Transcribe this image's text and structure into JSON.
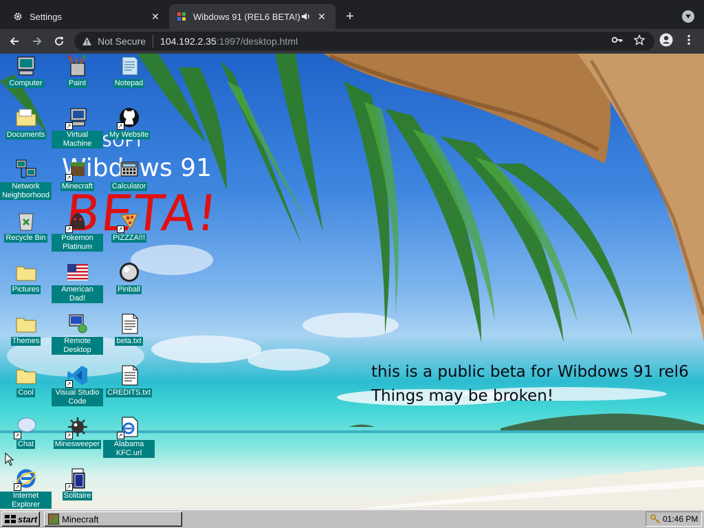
{
  "browser": {
    "tabs": [
      {
        "title": "Settings",
        "icon": "gear-icon",
        "active": false
      },
      {
        "title": "Wibdows 91 (REL6 BETA!)",
        "icon": "site-icon",
        "active": true,
        "audio": true
      }
    ],
    "new_tab_label": "+",
    "address": {
      "security_label": "Not Secure",
      "host": "104.192.2.35",
      "path": ":1997/desktop.html"
    }
  },
  "desktop": {
    "background_description_colors": {
      "sky": "#2a72d6",
      "sea": "#38cfd2",
      "sand": "#efece2"
    },
    "logo": {
      "top": "MIKASOFT",
      "name": "Wibdows 91",
      "tag": "BETA!"
    },
    "note_line1": "this is a public beta for Wibdows 91 rel6",
    "note_line2": "Things may be broken!",
    "icons": [
      {
        "label": "Computer",
        "icon": "computer-icon",
        "shortcut": false
      },
      {
        "label": "Paint",
        "icon": "paint-icon",
        "shortcut": false
      },
      {
        "label": "Notepad",
        "icon": "notepad-icon",
        "shortcut": false
      },
      {
        "label": "Documents",
        "icon": "folder-icon",
        "shortcut": false
      },
      {
        "label": "Virtual Machine",
        "icon": "virtual-machine-icon",
        "shortcut": true
      },
      {
        "label": "My Website",
        "icon": "github-icon",
        "shortcut": true
      },
      {
        "label": "Network Neighborhood",
        "icon": "network-icon",
        "shortcut": false
      },
      {
        "label": "Minecraft",
        "icon": "minecraft-icon",
        "shortcut": true
      },
      {
        "label": "Calculator",
        "icon": "calculator-icon",
        "shortcut": false
      },
      {
        "label": "Recycle Bin",
        "icon": "recycle-bin-icon",
        "shortcut": false
      },
      {
        "label": "Pokemon Platinum",
        "icon": "pokemon-icon",
        "shortcut": true
      },
      {
        "label": "PIZZZA!!!",
        "icon": "pizza-icon",
        "shortcut": true
      },
      {
        "label": "Pictures",
        "icon": "folder-icon",
        "shortcut": false
      },
      {
        "label": "American Dad!",
        "icon": "flag-icon",
        "shortcut": false
      },
      {
        "label": "Pinball",
        "icon": "pinball-icon",
        "shortcut": false
      },
      {
        "label": "Themes",
        "icon": "folder-icon",
        "shortcut": false
      },
      {
        "label": "Remote Desktop",
        "icon": "remote-desktop-icon",
        "shortcut": false
      },
      {
        "label": "beta.txt",
        "icon": "text-file-icon",
        "shortcut": false
      },
      {
        "label": "Cool",
        "icon": "folder-icon",
        "shortcut": false
      },
      {
        "label": "Visual Studio Code",
        "icon": "vscode-icon",
        "shortcut": true
      },
      {
        "label": "CREDITS.txt",
        "icon": "text-file-icon",
        "shortcut": false
      },
      {
        "label": "Chat",
        "icon": "chat-icon",
        "shortcut": true
      },
      {
        "label": "Minesweeper",
        "icon": "minesweeper-icon",
        "shortcut": true
      },
      {
        "label": "Alabama KFC.url",
        "icon": "internet-shortcut-icon",
        "shortcut": true
      },
      {
        "label": "Internet Explorer",
        "icon": "internet-explorer-icon",
        "shortcut": true
      },
      {
        "label": "Solitaire",
        "icon": "solitaire-icon",
        "shortcut": true
      }
    ]
  },
  "taskbar": {
    "start_label": "start",
    "tasks": [
      {
        "label": "Minecraft",
        "icon": "minecraft-icon"
      }
    ],
    "clock": "01:46 PM"
  }
}
